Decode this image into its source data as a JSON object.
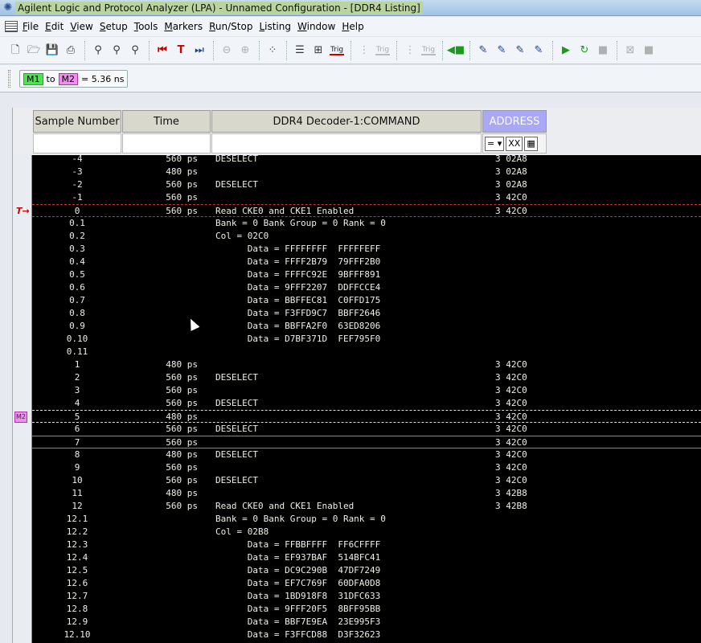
{
  "window": {
    "title": "Agilent Logic and Protocol Analyzer (LPA) - Unnamed Configuration - [DDR4 Listing]"
  },
  "menu": [
    "File",
    "Edit",
    "View",
    "Setup",
    "Tools",
    "Markers",
    "Run/Stop",
    "Listing",
    "Window",
    "Help"
  ],
  "toolbar": {
    "trig_label": "Trig"
  },
  "markers": {
    "m1": "M1",
    "to": "to",
    "m2": "M2",
    "delta": "= 5.36 ns"
  },
  "columns": {
    "sample": "Sample Number",
    "time": "Time",
    "command": "DDR4 Decoder-1:COMMAND",
    "address": "ADDRESS"
  },
  "address_filter": {
    "operator": "=",
    "value": "XX"
  },
  "gutter": {
    "trigger": "T",
    "m2": "M2"
  },
  "rows": [
    {
      "sn": "-4",
      "t": "560 ps",
      "cmd": "DESELECT",
      "addr": "3 02A8"
    },
    {
      "sn": "-3",
      "t": "480 ps",
      "cmd": "",
      "addr": "3 02A8"
    },
    {
      "sn": "-2",
      "t": "560 ps",
      "cmd": "DESELECT",
      "addr": "3 02A8"
    },
    {
      "sn": "-1",
      "t": "560 ps",
      "cmd": "",
      "addr": "3 42C0"
    },
    {
      "sn": "0",
      "t": "560 ps",
      "cmd": "Read CKE0 and CKE1 Enabled",
      "addr": "3 42C0",
      "mark": "trig"
    },
    {
      "sn": "0.1",
      "t": "",
      "cmd": "Bank = 0 Bank Group = 0 Rank = 0",
      "addr": ""
    },
    {
      "sn": "0.2",
      "t": "",
      "cmd": "Col = 02C0",
      "addr": ""
    },
    {
      "sn": "0.3",
      "t": "",
      "cmd": "      Data = FFFFFFFF  FFFFFEFF",
      "addr": ""
    },
    {
      "sn": "0.4",
      "t": "",
      "cmd": "      Data = FFFF2B79  79FFF2B0",
      "addr": ""
    },
    {
      "sn": "0.5",
      "t": "",
      "cmd": "      Data = FFFFC92E  9BFFF891",
      "addr": ""
    },
    {
      "sn": "0.6",
      "t": "",
      "cmd": "      Data = 9FFF2207  DDFFCCE4",
      "addr": ""
    },
    {
      "sn": "0.7",
      "t": "",
      "cmd": "      Data = BBFFEC81  C0FFD175",
      "addr": ""
    },
    {
      "sn": "0.8",
      "t": "",
      "cmd": "      Data = F3FFD9C7  BBFF2646",
      "addr": ""
    },
    {
      "sn": "0.9",
      "t": "",
      "cmd": "      Data = BBFFA2F0  63ED8206",
      "addr": ""
    },
    {
      "sn": "0.10",
      "t": "",
      "cmd": "      Data = D7BF371D  FEF795F0",
      "addr": ""
    },
    {
      "sn": "0.11",
      "t": "",
      "cmd": "",
      "addr": ""
    },
    {
      "sn": "1",
      "t": "480 ps",
      "cmd": "",
      "addr": "3 42C0"
    },
    {
      "sn": "2",
      "t": "560 ps",
      "cmd": "DESELECT",
      "addr": "3 42C0"
    },
    {
      "sn": "3",
      "t": "560 ps",
      "cmd": "",
      "addr": "3 42C0"
    },
    {
      "sn": "4",
      "t": "560 ps",
      "cmd": "DESELECT",
      "addr": "3 42C0"
    },
    {
      "sn": "5",
      "t": "480 ps",
      "cmd": "",
      "addr": "3 42C0",
      "mark": "m2"
    },
    {
      "sn": "6",
      "t": "560 ps",
      "cmd": "DESELECT",
      "addr": "3 42C0"
    },
    {
      "sn": "7",
      "t": "560 ps",
      "cmd": "",
      "addr": "3 42C0",
      "mark": "sel"
    },
    {
      "sn": "8",
      "t": "480 ps",
      "cmd": "DESELECT",
      "addr": "3 42C0"
    },
    {
      "sn": "9",
      "t": "560 ps",
      "cmd": "",
      "addr": "3 42C0"
    },
    {
      "sn": "10",
      "t": "560 ps",
      "cmd": "DESELECT",
      "addr": "3 42C0"
    },
    {
      "sn": "11",
      "t": "480 ps",
      "cmd": "",
      "addr": "3 42B8"
    },
    {
      "sn": "12",
      "t": "560 ps",
      "cmd": "Read CKE0 and CKE1 Enabled",
      "addr": "3 42B8"
    },
    {
      "sn": "12.1",
      "t": "",
      "cmd": "Bank = 0 Bank Group = 0 Rank = 0",
      "addr": ""
    },
    {
      "sn": "12.2",
      "t": "",
      "cmd": "Col = 02B8",
      "addr": ""
    },
    {
      "sn": "12.3",
      "t": "",
      "cmd": "      Data = FFBBFFFF  FF6CFFFF",
      "addr": ""
    },
    {
      "sn": "12.4",
      "t": "",
      "cmd": "      Data = EF937BAF  514BFC41",
      "addr": ""
    },
    {
      "sn": "12.5",
      "t": "",
      "cmd": "      Data = DC9C290B  47DF7249",
      "addr": ""
    },
    {
      "sn": "12.6",
      "t": "",
      "cmd": "      Data = EF7C769F  60DFA0D8",
      "addr": ""
    },
    {
      "sn": "12.7",
      "t": "",
      "cmd": "      Data = 1BD918F8  31DFC633",
      "addr": ""
    },
    {
      "sn": "12.8",
      "t": "",
      "cmd": "      Data = 9FFF20F5  8BFF95BB",
      "addr": ""
    },
    {
      "sn": "12.9",
      "t": "",
      "cmd": "      Data = BBF7E9EA  23E995F3",
      "addr": ""
    },
    {
      "sn": "12.10",
      "t": "",
      "cmd": "      Data = F3FFCD88  D3F32623",
      "addr": ""
    }
  ]
}
